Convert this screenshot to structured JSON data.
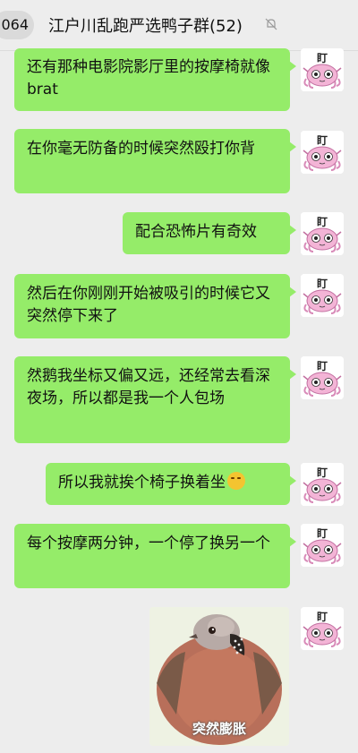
{
  "header": {
    "unread_count": "064",
    "title": "江户川乱跑严选鸭子群(52)",
    "mute_icon": "bell-off-icon"
  },
  "colors": {
    "bubble": "#95ec69",
    "background": "#ededed"
  },
  "messages": [
    {
      "text": "还有那种电影院影厅里的按摩椅就像 brat"
    },
    {
      "text": "在你毫无防备的时候突然殴打你背"
    },
    {
      "text": "配合恐怖片有奇效"
    },
    {
      "text": "然后在你刚刚开始被吸引的时候它又突然停下来了"
    },
    {
      "text": "然鹅我坐标又偏又远，还经常去看深夜场，所以都是我一个人包场"
    },
    {
      "text": "所以我就挨个椅子换着坐",
      "emoji": "laughing-crying-emoji"
    },
    {
      "text": "每个按摩两分钟，一个停了换另一个"
    }
  ],
  "sticker": {
    "caption": "突然膨胀"
  },
  "avatar": {
    "label": "盯"
  }
}
